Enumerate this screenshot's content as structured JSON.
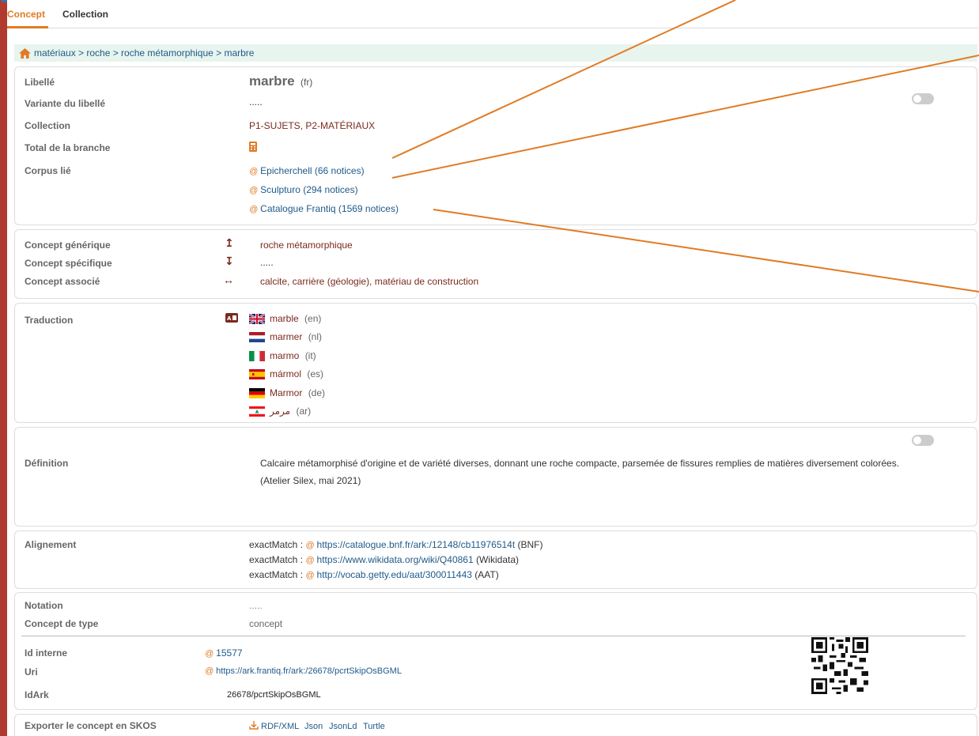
{
  "tabs": [
    {
      "label": "Concept",
      "active": true
    },
    {
      "label": "Collection",
      "active": false
    }
  ],
  "breadcrumb": "matériaux > roche > roche métamorphique > marbre",
  "main": {
    "libelle_label": "Libellé",
    "libelle_value": "marbre",
    "libelle_lang": "(fr)",
    "variante_label": "Variante du libellé",
    "variante_value": ".....",
    "collection_label": "Collection",
    "collection_value": "P1-SUJETS, P2-MATÉRIAUX",
    "total_label": "Total de la branche",
    "corpus_label": "Corpus lié",
    "corpus": [
      "Epicherchell (66 notices)",
      "Sculpturo (294 notices)",
      "Catalogue Frantiq (1569 notices)"
    ]
  },
  "relations": {
    "generic_label": "Concept générique",
    "generic_value": "roche métamorphique",
    "specific_label": "Concept spécifique",
    "specific_value": ".....",
    "associated_label": "Concept associé",
    "associated_value": "calcite, carrière (géologie), matériau de construction"
  },
  "translation": {
    "label": "Traduction",
    "items": [
      {
        "term": "marble",
        "lang": "(en)",
        "flag": "uk-flag-icon"
      },
      {
        "term": "marmer",
        "lang": "(nl)",
        "flag": "netherlands-flag-icon"
      },
      {
        "term": "marmo",
        "lang": "(it)",
        "flag": "italy-flag-icon"
      },
      {
        "term": "mármol",
        "lang": "(es)",
        "flag": "spain-flag-icon"
      },
      {
        "term": "Marmor",
        "lang": "(de)",
        "flag": "germany-flag-icon"
      },
      {
        "term": "مرمر",
        "lang": "(ar)",
        "flag": "lebanon-flag-icon"
      }
    ]
  },
  "definition": {
    "label": "Définition",
    "line1": "Calcaire métamorphisé d'origine et de variété diverses, donnant une roche compacte, parsemée de fissures remplies de matières diversement colorées.",
    "line2": "(Atelier Silex, mai 2021)"
  },
  "alignment": {
    "label": "Alignement",
    "prefix": "exactMatch :",
    "items": [
      {
        "url": "https://catalogue.bnf.fr/ark:/12148/cb11976514t",
        "source": "(BNF)"
      },
      {
        "url": "https://www.wikidata.org/wiki/Q40861",
        "source": "(Wikidata)"
      },
      {
        "url": "http://vocab.getty.edu/aat/300011443",
        "source": "(AAT)"
      }
    ]
  },
  "meta": {
    "notation_label": "Notation",
    "notation_value": ".....",
    "type_label": "Concept de type",
    "type_value": "concept",
    "id_label": "Id interne",
    "id_value": "15577",
    "uri_label": "Uri",
    "uri_value": "https://ark.frantiq.fr/ark:/26678/pcrtSkipOsBGML",
    "idark_label": "IdArk",
    "idark_value": "26678/pcrtSkipOsBGML"
  },
  "export": {
    "label": "Exporter le concept en SKOS",
    "formats": [
      "RDF/XML",
      "Json",
      "JsonLd",
      "Turtle"
    ]
  },
  "colors": {
    "accent": "#e07b24",
    "link": "#1f5a8a",
    "value_red": "#7a2a1e",
    "breadcrumb_bg": "#e8f4ee",
    "sidebar_strip": "#b03a2e"
  }
}
